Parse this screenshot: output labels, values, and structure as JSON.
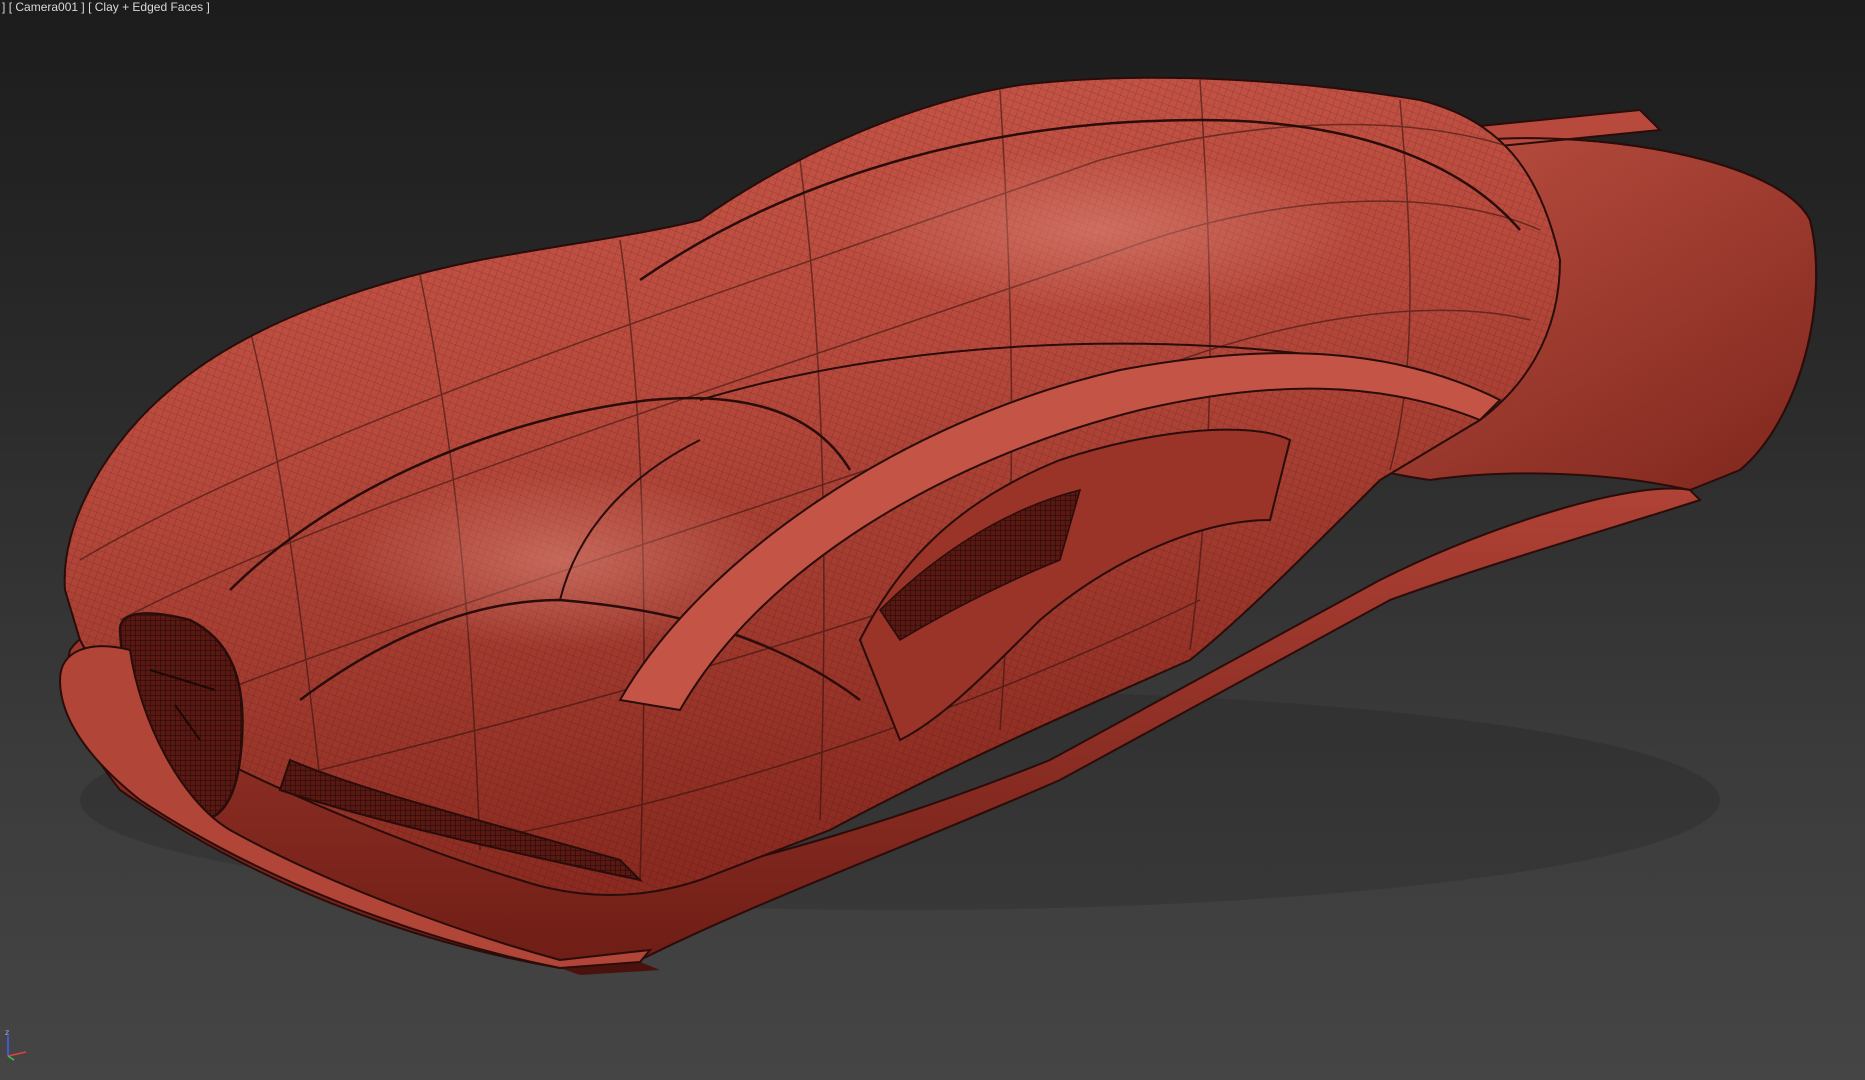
{
  "viewport": {
    "label_parts": [
      "]",
      "[ Camera001 ]",
      "[ Clay + Edged Faces ]"
    ],
    "background_top": "#1c1c1c",
    "background_bottom": "#454545"
  },
  "model": {
    "shading": "clay-edged-faces",
    "clay_color": "#b8483b",
    "clay_shadow": "#7a2219",
    "edge_color": "#2a0d0a"
  },
  "gizmo": {
    "z_label": "z",
    "icon": "axis-tripod-icon",
    "colors": {
      "x": "#e04040",
      "y": "#40c040",
      "z": "#4060ff"
    }
  }
}
